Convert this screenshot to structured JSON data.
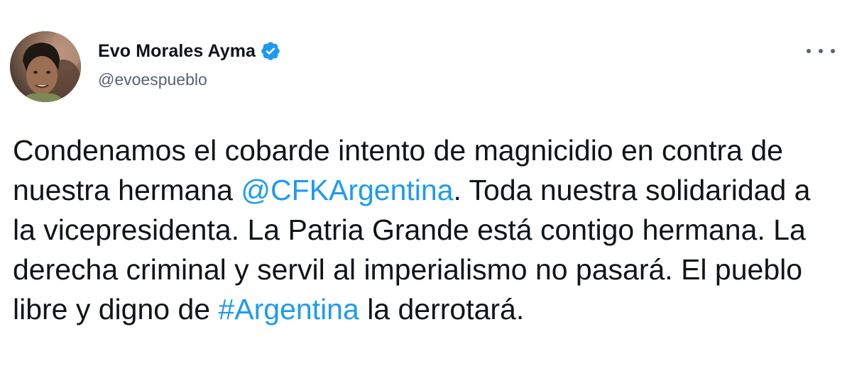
{
  "author": {
    "display_name": "Evo Morales Ayma",
    "handle": "@evoespueblo",
    "verified_icon": "verified-badge-icon",
    "avatar_alt": "avatar"
  },
  "menu": {
    "icon": "more-horizontal-icon"
  },
  "tweet": {
    "seg1": "Condenamos el cobarde intento de magnicidio en contra de nuestra hermana ",
    "mention": "@CFKArgentina",
    "seg2": ". Toda nuestra solidaridad a la vicepresidenta. La Patria Grande está contigo hermana. La derecha criminal y servil al imperialismo no pasará. El pueblo libre y digno de ",
    "hashtag": "#Argentina",
    "seg3": " la derrotará."
  },
  "colors": {
    "link": "#1d9bf0",
    "text": "#0f1419",
    "secondary": "#536471",
    "verified": "#1d9bf0"
  }
}
